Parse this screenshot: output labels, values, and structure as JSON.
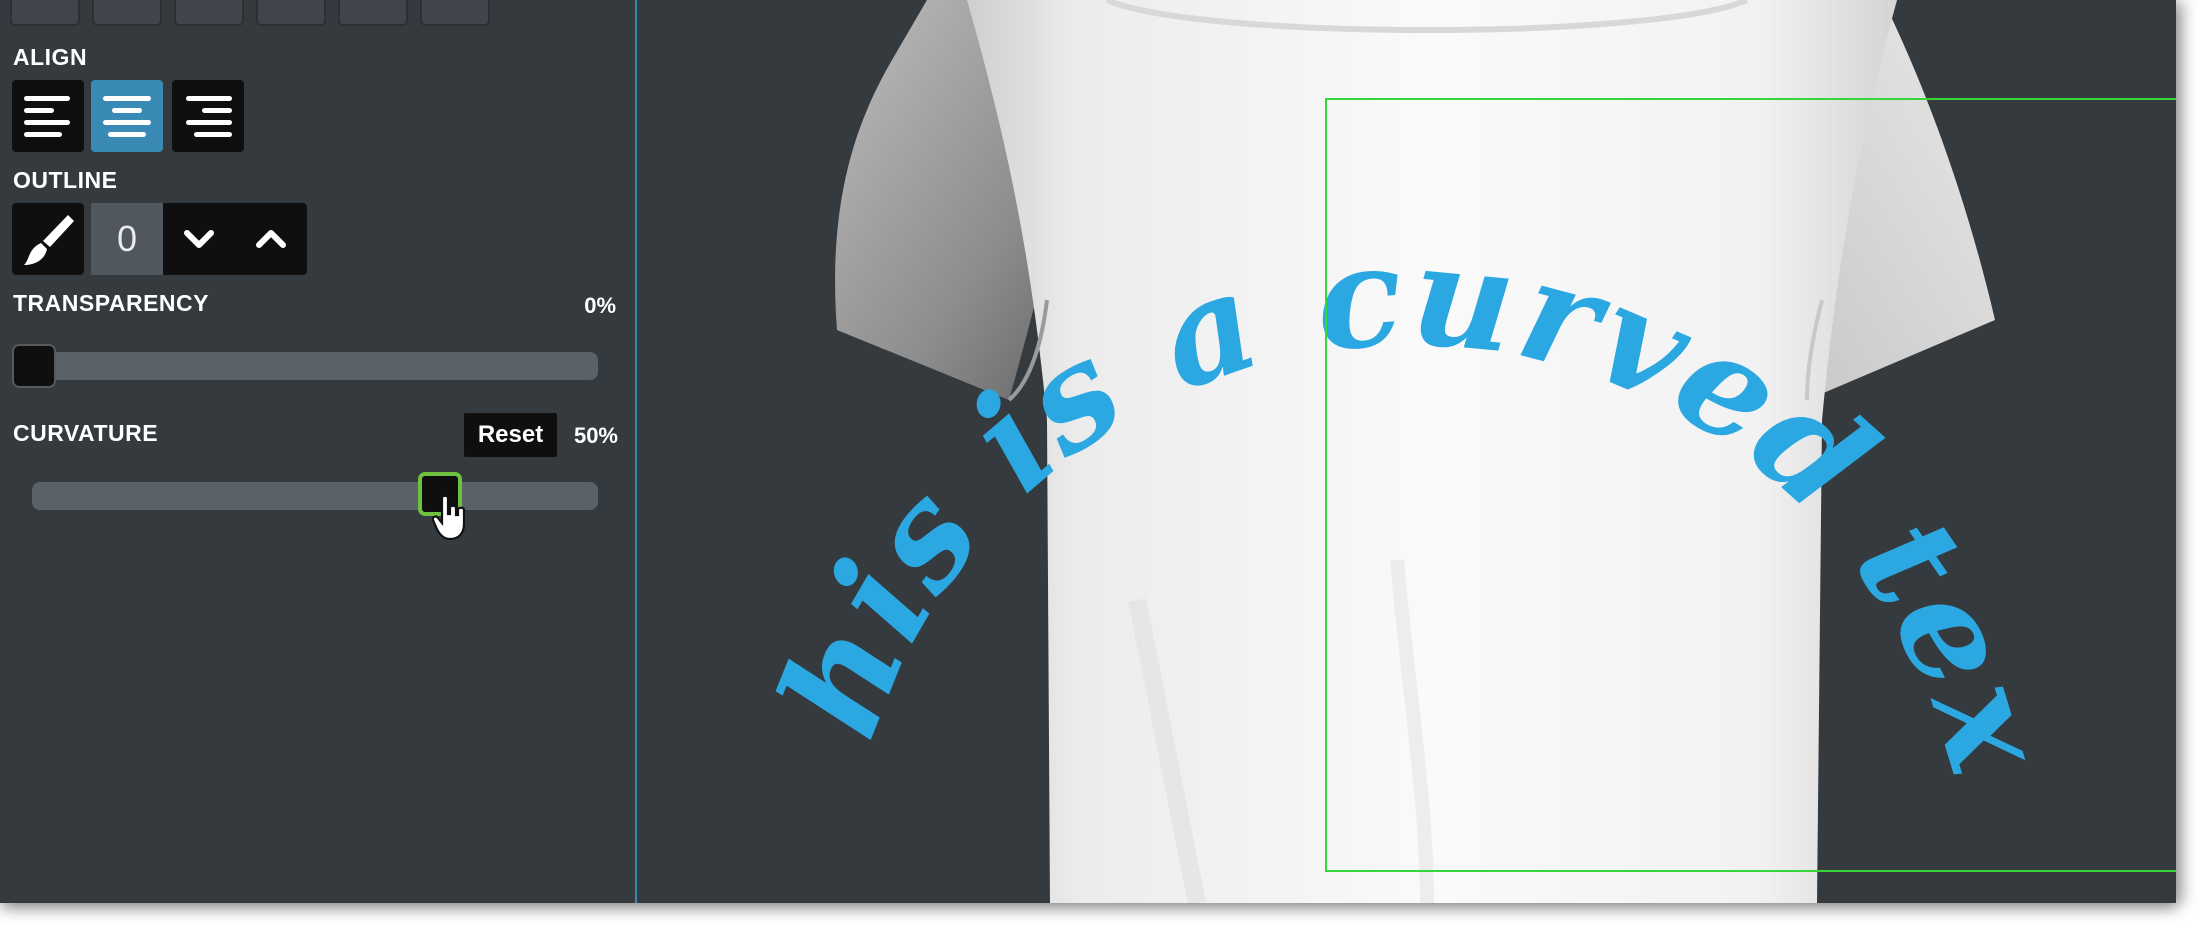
{
  "panel": {
    "align": {
      "label": "ALIGN",
      "buttons": [
        {
          "name": "align-left",
          "active": false
        },
        {
          "name": "align-center",
          "active": true
        },
        {
          "name": "align-right",
          "active": false
        }
      ]
    },
    "outline": {
      "label": "OUTLINE",
      "value": "0",
      "brush_icon": "paintbrush-icon",
      "down_icon": "chevron-down-icon",
      "up_icon": "chevron-up-icon"
    },
    "transparency": {
      "label": "TRANSPARENCY",
      "value_label": "0%",
      "value": 0
    },
    "curvature": {
      "label": "CURVATURE",
      "reset_label": "Reset",
      "value_label": "50%",
      "value": 0.74
    }
  },
  "canvas": {
    "curved_text": "This is a curved text",
    "text_color": "#2ba8e2",
    "selection_color": "#36d639"
  },
  "colors": {
    "panel_bg": "#353a3f",
    "accent": "#3a8ab6",
    "focus": "#6fc23d"
  }
}
